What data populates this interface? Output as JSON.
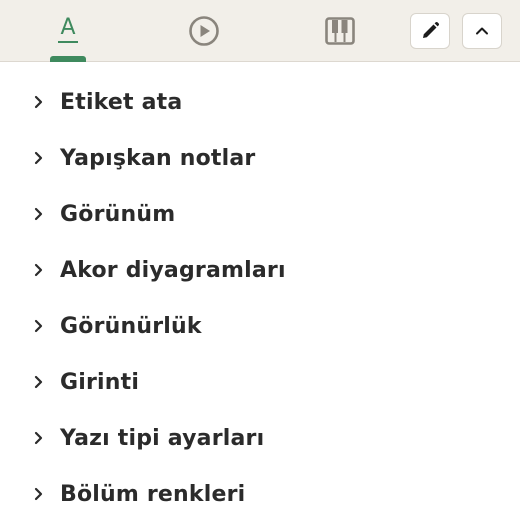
{
  "toolbar": {
    "tabs": [
      {
        "label": "A",
        "icon": "text-format-icon",
        "active": true
      },
      {
        "icon": "play-circle-icon",
        "active": false
      },
      {
        "icon": "piano-keys-icon",
        "active": false
      }
    ],
    "buttons": [
      {
        "icon": "pencil-icon"
      },
      {
        "icon": "chevron-up-icon"
      }
    ],
    "accent_color": "#3f8a5e",
    "icon_color": "#8a857d"
  },
  "sections": [
    {
      "label": "Etiket ata"
    },
    {
      "label": "Yapışkan notlar"
    },
    {
      "label": "Görünüm"
    },
    {
      "label": "Akor diyagramları"
    },
    {
      "label": "Görünürlük"
    },
    {
      "label": "Girinti"
    },
    {
      "label": "Yazı tipi ayarları"
    },
    {
      "label": "Bölüm renkleri"
    }
  ]
}
